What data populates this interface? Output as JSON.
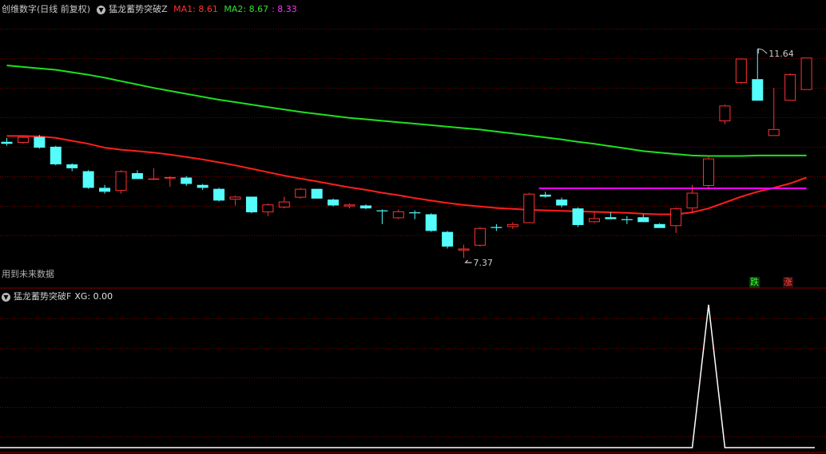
{
  "top_header": {
    "stock_name": "创维数字",
    "period": "(日线 前复权)",
    "indicator_name": "猛龙蓄势突破Z",
    "ma1_label": "MA1: 8.61",
    "ma2_label": "MA2: 8.67",
    "extra_value": ": 8.33"
  },
  "bottom_header": {
    "indicator_name": "猛龙蓄势突破F",
    "xg_label": "XG: 0.00"
  },
  "future_data_note": "用到未来数据",
  "badges": {
    "down": "跌",
    "up": "涨"
  },
  "colors": {
    "up": "#ff3232",
    "down": "#54fcfc",
    "ma1": "#ff1e1e",
    "ma2": "#1ee11e",
    "level": "#ff00ff",
    "xg": "#ffffff",
    "grid": "#7a0000",
    "text": "#c0c0c0"
  },
  "chart_data": [
    {
      "type": "candlestick",
      "ylim": [
        6.9,
        12.05
      ],
      "annotations": [
        {
          "text": "11.64",
          "x": 46,
          "y": 11.64
        },
        {
          "text": "7.37",
          "x": 28,
          "y": 7.37
        }
      ],
      "candles": [
        {
          "x": 0,
          "open": 9.74,
          "high": 9.82,
          "low": 9.66,
          "close": 9.7
        },
        {
          "x": 1,
          "open": 9.72,
          "high": 9.86,
          "low": 9.7,
          "close": 9.84
        },
        {
          "x": 2,
          "open": 9.84,
          "high": 9.88,
          "low": 9.6,
          "close": 9.62
        },
        {
          "x": 3,
          "open": 9.64,
          "high": 9.66,
          "low": 9.26,
          "close": 9.28
        },
        {
          "x": 4,
          "open": 9.28,
          "high": 9.3,
          "low": 9.14,
          "close": 9.2
        },
        {
          "x": 5,
          "open": 9.14,
          "high": 9.16,
          "low": 8.78,
          "close": 8.8
        },
        {
          "x": 6,
          "open": 8.8,
          "high": 8.86,
          "low": 8.68,
          "close": 8.72
        },
        {
          "x": 7,
          "open": 8.74,
          "high": 9.16,
          "low": 8.68,
          "close": 9.14
        },
        {
          "x": 8,
          "open": 9.1,
          "high": 9.16,
          "low": 8.98,
          "close": 8.98
        },
        {
          "x": 9,
          "open": 8.98,
          "high": 9.2,
          "low": 8.96,
          "close": 8.99
        },
        {
          "x": 10,
          "open": 8.99,
          "high": 9.04,
          "low": 8.82,
          "close": 9.02
        },
        {
          "x": 11,
          "open": 9.01,
          "high": 9.04,
          "low": 8.84,
          "close": 8.88
        },
        {
          "x": 12,
          "open": 8.86,
          "high": 8.88,
          "low": 8.76,
          "close": 8.8
        },
        {
          "x": 13,
          "open": 8.78,
          "high": 8.8,
          "low": 8.52,
          "close": 8.54
        },
        {
          "x": 14,
          "open": 8.56,
          "high": 8.64,
          "low": 8.44,
          "close": 8.62
        },
        {
          "x": 15,
          "open": 8.62,
          "high": 8.62,
          "low": 8.28,
          "close": 8.3
        },
        {
          "x": 16,
          "open": 8.3,
          "high": 8.48,
          "low": 8.22,
          "close": 8.46
        },
        {
          "x": 17,
          "open": 8.4,
          "high": 8.62,
          "low": 8.38,
          "close": 8.52
        },
        {
          "x": 18,
          "open": 8.6,
          "high": 8.8,
          "low": 8.58,
          "close": 8.78
        },
        {
          "x": 19,
          "open": 8.78,
          "high": 8.78,
          "low": 8.58,
          "close": 8.58
        },
        {
          "x": 20,
          "open": 8.56,
          "high": 8.58,
          "low": 8.42,
          "close": 8.44
        },
        {
          "x": 21,
          "open": 8.42,
          "high": 8.48,
          "low": 8.38,
          "close": 8.46
        },
        {
          "x": 22,
          "open": 8.44,
          "high": 8.46,
          "low": 8.36,
          "close": 8.38
        },
        {
          "x": 23,
          "open": 8.34,
          "high": 8.36,
          "low": 8.06,
          "close": 8.32
        },
        {
          "x": 24,
          "open": 8.18,
          "high": 8.36,
          "low": 8.16,
          "close": 8.32
        },
        {
          "x": 25,
          "open": 8.3,
          "high": 8.34,
          "low": 8.16,
          "close": 8.28
        },
        {
          "x": 26,
          "open": 8.26,
          "high": 8.28,
          "low": 7.9,
          "close": 7.92
        },
        {
          "x": 27,
          "open": 7.9,
          "high": 7.92,
          "low": 7.56,
          "close": 7.6
        },
        {
          "x": 28,
          "open": 7.52,
          "high": 7.64,
          "low": 7.37,
          "close": 7.56
        },
        {
          "x": 29,
          "open": 7.62,
          "high": 8.0,
          "low": 7.6,
          "close": 7.98
        },
        {
          "x": 30,
          "open": 8.0,
          "high": 8.06,
          "low": 7.92,
          "close": 7.98
        },
        {
          "x": 31,
          "open": 8.0,
          "high": 8.1,
          "low": 7.96,
          "close": 8.06
        },
        {
          "x": 32,
          "open": 8.08,
          "high": 8.7,
          "low": 8.08,
          "close": 8.68
        },
        {
          "x": 33,
          "open": 8.66,
          "high": 8.72,
          "low": 8.6,
          "close": 8.62
        },
        {
          "x": 34,
          "open": 8.56,
          "high": 8.6,
          "low": 8.4,
          "close": 8.44
        },
        {
          "x": 35,
          "open": 8.38,
          "high": 8.4,
          "low": 8.0,
          "close": 8.04
        },
        {
          "x": 36,
          "open": 8.1,
          "high": 8.3,
          "low": 8.08,
          "close": 8.18
        },
        {
          "x": 37,
          "open": 8.2,
          "high": 8.3,
          "low": 8.18,
          "close": 8.16
        },
        {
          "x": 38,
          "open": 8.16,
          "high": 8.22,
          "low": 8.06,
          "close": 8.14
        },
        {
          "x": 39,
          "open": 8.2,
          "high": 8.26,
          "low": 8.1,
          "close": 8.1
        },
        {
          "x": 40,
          "open": 8.06,
          "high": 8.08,
          "low": 7.98,
          "close": 7.98
        },
        {
          "x": 41,
          "open": 8.02,
          "high": 8.4,
          "low": 7.88,
          "close": 8.38
        },
        {
          "x": 42,
          "open": 8.38,
          "high": 8.86,
          "low": 8.3,
          "close": 8.7
        },
        {
          "x": 43,
          "open": 8.84,
          "high": 9.44,
          "low": 8.8,
          "close": 9.4
        },
        {
          "x": 44,
          "open": 10.16,
          "high": 10.5,
          "low": 10.1,
          "close": 10.48
        },
        {
          "x": 45,
          "open": 10.94,
          "high": 11.44,
          "low": 10.92,
          "close": 11.44
        },
        {
          "x": 46,
          "open": 11.02,
          "high": 11.64,
          "low": 10.58,
          "close": 10.58
        },
        {
          "x": 47,
          "open": 9.86,
          "high": 10.84,
          "low": 9.86,
          "close": 10.0
        },
        {
          "x": 48,
          "open": 10.58,
          "high": 11.14,
          "low": 10.58,
          "close": 11.12
        },
        {
          "x": 49,
          "open": 10.8,
          "high": 11.46,
          "low": 10.8,
          "close": 11.46
        }
      ],
      "series": [
        {
          "name": "MA1",
          "values": [
            9.86,
            9.86,
            9.85,
            9.82,
            9.76,
            9.7,
            9.62,
            9.58,
            9.55,
            9.52,
            9.48,
            9.43,
            9.38,
            9.32,
            9.26,
            9.19,
            9.12,
            9.05,
            8.99,
            8.93,
            8.87,
            8.81,
            8.76,
            8.7,
            8.65,
            8.59,
            8.54,
            8.49,
            8.45,
            8.42,
            8.39,
            8.37,
            8.35,
            8.34,
            8.33,
            8.32,
            8.31,
            8.3,
            8.29,
            8.27,
            8.26,
            8.26,
            8.3,
            8.38,
            8.5,
            8.62,
            8.72,
            8.8,
            8.89,
            9.01
          ]
        },
        {
          "name": "MA2",
          "values": [
            11.3,
            11.27,
            11.24,
            11.21,
            11.16,
            11.11,
            11.05,
            10.98,
            10.91,
            10.84,
            10.78,
            10.72,
            10.66,
            10.6,
            10.55,
            10.5,
            10.45,
            10.4,
            10.35,
            10.31,
            10.27,
            10.23,
            10.2,
            10.17,
            10.14,
            10.11,
            10.08,
            10.05,
            10.02,
            9.99,
            9.95,
            9.91,
            9.87,
            9.83,
            9.79,
            9.74,
            9.7,
            9.65,
            9.6,
            9.55,
            9.52,
            9.49,
            9.46,
            9.45,
            9.45,
            9.45,
            9.46,
            9.46,
            9.46,
            9.46
          ]
        }
      ],
      "level_line": {
        "y": 8.79,
        "x_start": 33,
        "x_end": 49
      }
    },
    {
      "type": "line",
      "name": "XG",
      "ylim": [
        0,
        1
      ],
      "values": [
        0,
        0,
        0,
        0,
        0,
        0,
        0,
        0,
        0,
        0,
        0,
        0,
        0,
        0,
        0,
        0,
        0,
        0,
        0,
        0,
        0,
        0,
        0,
        0,
        0,
        0,
        0,
        0,
        0,
        0,
        0,
        0,
        0,
        0,
        0,
        0,
        0,
        0,
        0,
        0,
        0,
        0,
        0,
        1,
        0,
        0,
        0,
        0,
        0,
        0
      ]
    }
  ]
}
